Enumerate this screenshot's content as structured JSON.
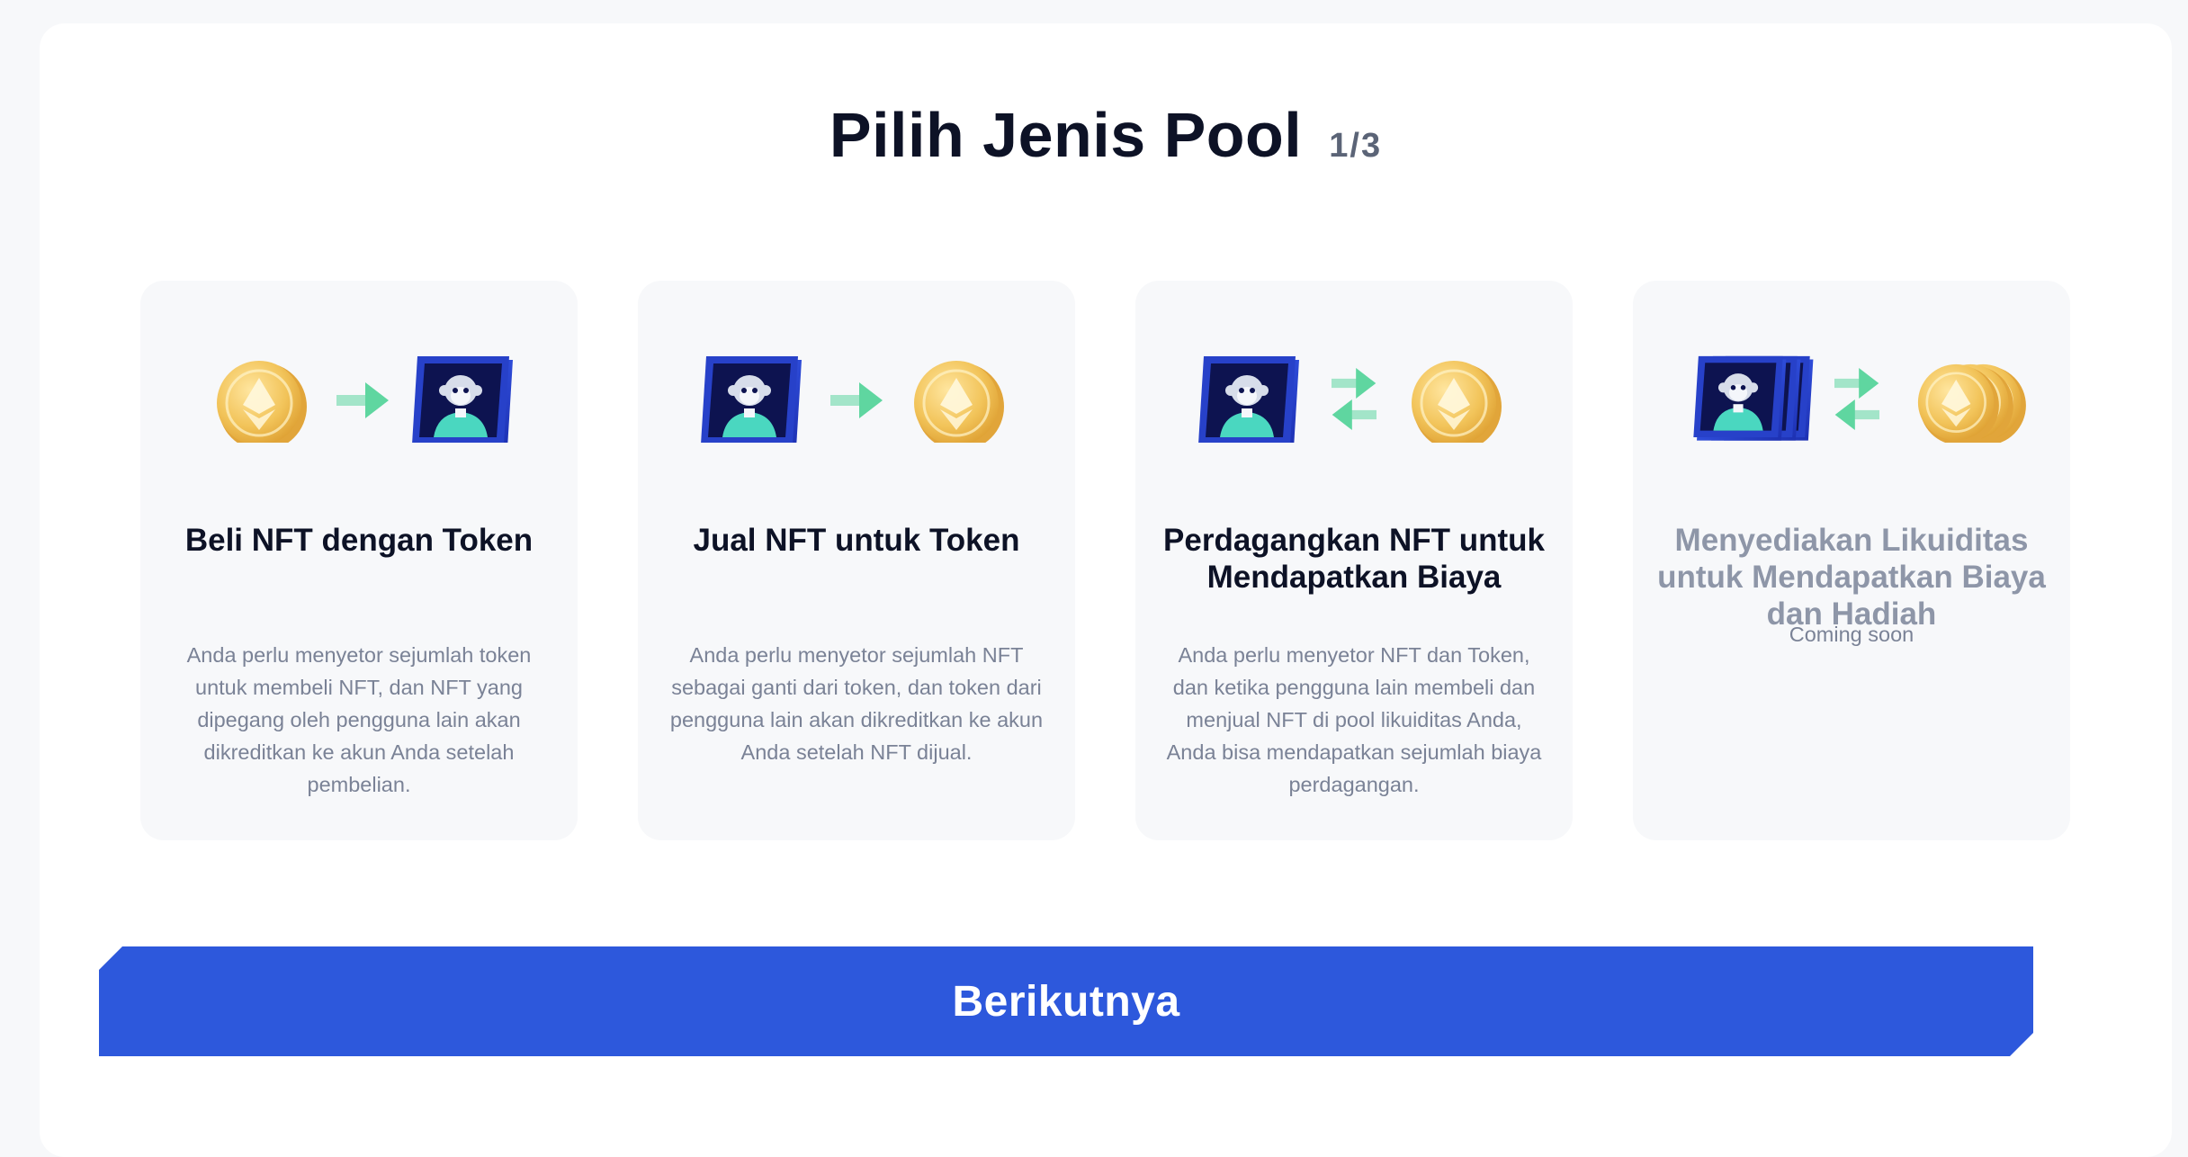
{
  "header": {
    "title": "Pilih Jenis Pool",
    "step": "1/3"
  },
  "cards": [
    {
      "title": "Beli NFT dengan Token",
      "description": "Anda perlu menyetor sejumlah token untuk membeli NFT, dan NFT yang dipegang oleh pengguna lain akan dikreditkan ke akun Anda setelah pembelian.",
      "icons": [
        "eth-coin-icon",
        "arrow-right-icon",
        "nft-card-icon"
      ]
    },
    {
      "title": "Jual NFT untuk Token",
      "description": "Anda perlu menyetor sejumlah NFT sebagai ganti dari token, dan token dari pengguna lain akan dikreditkan ke akun Anda setelah NFT dijual.",
      "icons": [
        "nft-card-icon",
        "arrow-right-icon",
        "eth-coin-icon"
      ]
    },
    {
      "title": "Perdagangkan NFT untuk Mendapatkan Biaya",
      "description": "Anda perlu menyetor NFT dan Token, dan ketika pengguna lain membeli dan menjual NFT di pool likuiditas Anda, Anda bisa mendapatkan sejumlah biaya perdagangan.",
      "icons": [
        "nft-card-icon",
        "swap-arrows-icon",
        "eth-coin-icon"
      ]
    },
    {
      "title": "Menyediakan Likuiditas untuk Mendapatkan Biaya dan Hadiah",
      "status": "Coming soon",
      "icons": [
        "nft-card-stack-icon",
        "swap-arrows-icon",
        "eth-coin-stack-icon"
      ]
    }
  ],
  "colors": {
    "primary": "#2d58dc",
    "arrow": "#5fd6a0",
    "coin": "#f2c45a",
    "nft": "#2741c9",
    "card_bg": "#f7f8fa"
  },
  "next_button": {
    "label": "Berikutnya"
  }
}
